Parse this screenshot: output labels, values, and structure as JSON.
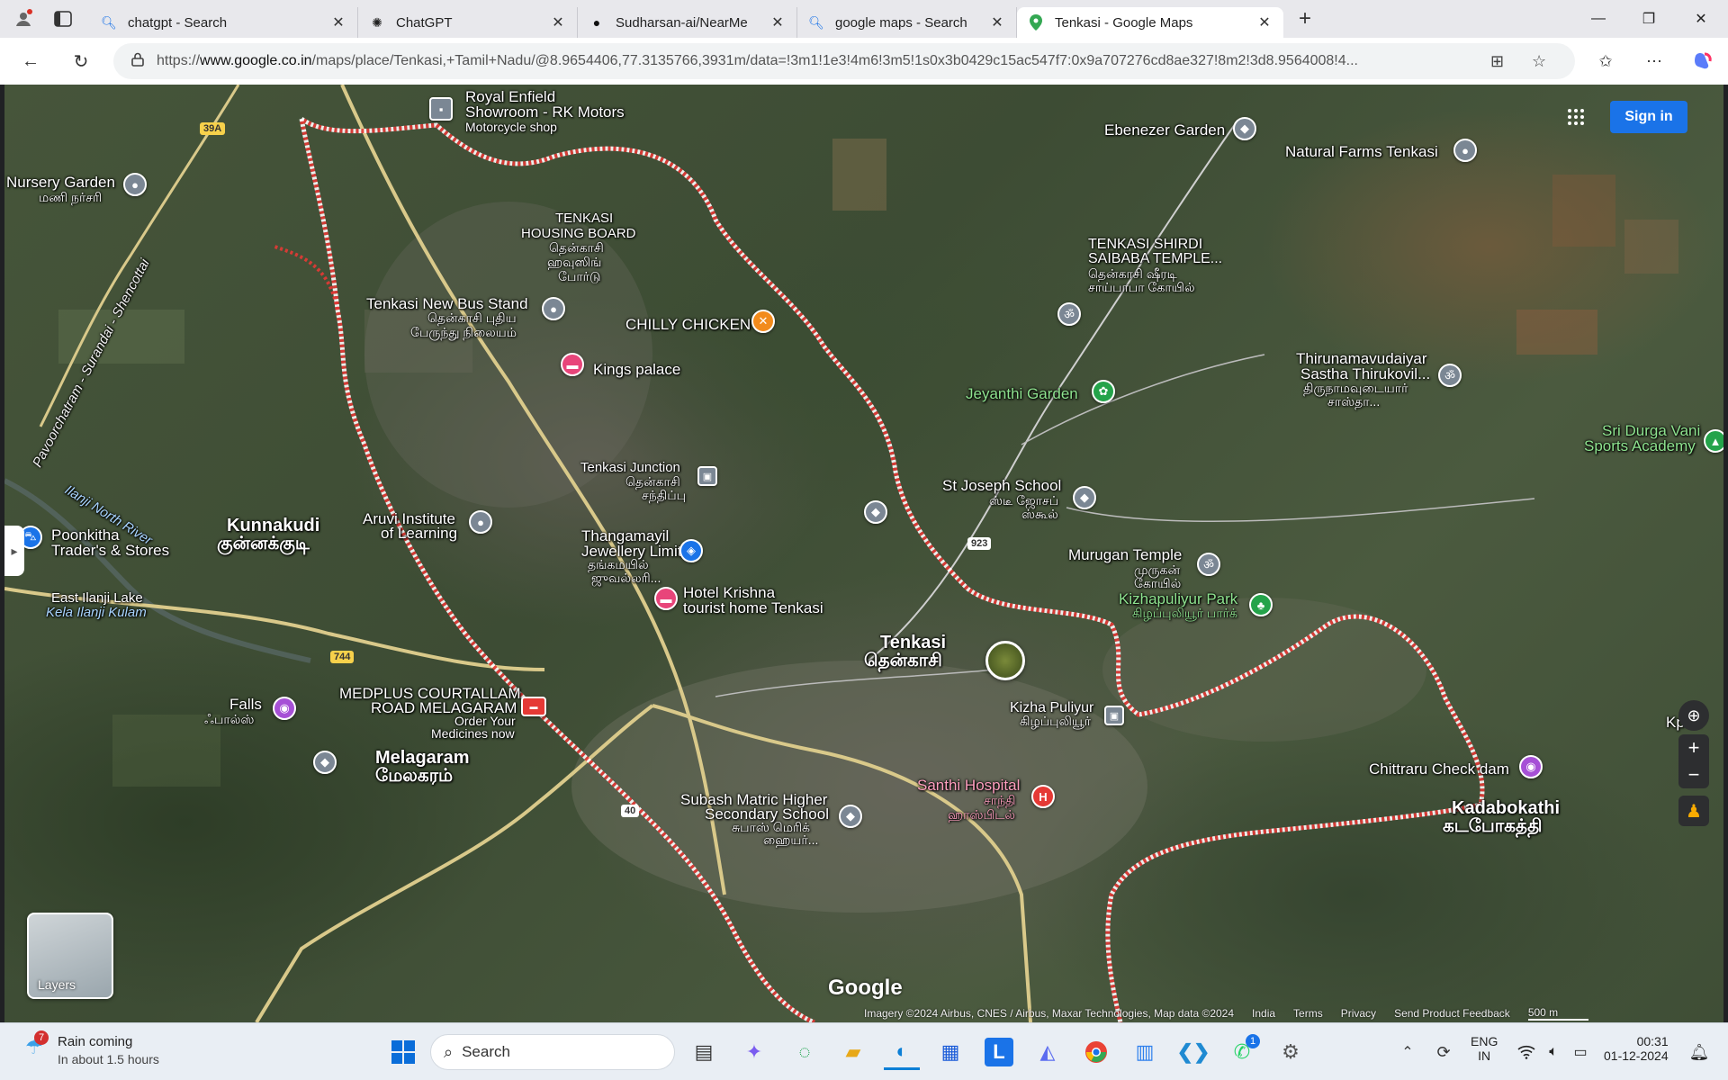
{
  "browser": {
    "tabs": [
      {
        "title": "chatgpt - Search",
        "icon": "search-icon"
      },
      {
        "title": "ChatGPT",
        "icon": "chatgpt-icon"
      },
      {
        "title": "Sudharsan-ai/NearMe",
        "icon": "github-icon"
      },
      {
        "title": "google maps - Search",
        "icon": "search-icon"
      },
      {
        "title": "Tenkasi - Google Maps",
        "icon": "maps-pin-icon"
      }
    ],
    "url_domain": "www.google.co.in",
    "url_prefix": "https://",
    "url_path": "/maps/place/Tenkasi,+Tamil+Nadu/@8.9654406,77.3135766,3931m/data=!3m1!1e3!4m6!3m5!1s0x3b0429c15ac547f7:0x9a707276cd8ae327!8m2!3d8.9564008!4..."
  },
  "map": {
    "signin_label": "Sign in",
    "layers_label": "Layers",
    "logo": "Google",
    "attribution": [
      "Imagery ©2024 Airbus, CNES / Airbus, Maxar Technologies, Map data ©2024",
      "India",
      "Terms",
      "Privacy",
      "Send Product Feedback",
      "500 m"
    ],
    "places": {
      "royal_enfield": [
        "Royal Enfield",
        "Showroom - RK Motors",
        "Motorcycle shop"
      ],
      "ebenezer": "Ebenezer Garden",
      "natural_farms": "Natural Farms Tenkasi",
      "nursery": [
        "Nursery Garden",
        "மணி நர்சரி"
      ],
      "housing_board": [
        "TENKASI",
        "HOUSING BOARD",
        "தென்காசி",
        "ஹவுஸிங்",
        "போர்டு"
      ],
      "shirdi": [
        "TENKASI SHIRDI",
        "SAIBABA TEMPLE...",
        "தென்காசி ஷீரடி",
        "சாய்பாபா கோயில்"
      ],
      "bus_stand": [
        "Tenkasi New Bus Stand",
        "தென்காசி புதிய",
        "பேருந்து நிலையம்"
      ],
      "chilly": "CHILLY CHICKEN",
      "kings": "Kings palace",
      "thiruna": [
        "Thirunamavudaiyar",
        "Sastha Thirukovil...",
        "திருநாமவுடையார்",
        "சாஸ்தா..."
      ],
      "jeyanthi": "Jeyanthi Garden",
      "sri_durga": [
        "Sri Durga Vani",
        "Sports Academy"
      ],
      "junction": [
        "Tenkasi Junction",
        "தென்காசி",
        "சந்திப்பு"
      ],
      "st_joseph": [
        "St Joseph School",
        "ஸ்டீ ஜோசப்",
        "ஸ்கூல்"
      ],
      "kunnakudi": [
        "Kunnakudi",
        "குன்னக்குடி"
      ],
      "aruvi": [
        "Aruvi Institute",
        "of Learning"
      ],
      "thangamayil": [
        "Thangamayil",
        "Jewellery Limited",
        "தங்கமயில்",
        "ஜுவல்லரி..."
      ],
      "poonkitha": [
        "Poonkitha",
        "Trader's & Stores"
      ],
      "murugan": [
        "Murugan Temple",
        "முருகன்",
        "கோயில்"
      ],
      "kizhapuliyur_park": [
        "Kizhapuliyur Park",
        "கிழப்புலியூர் பார்க்"
      ],
      "east_ilanji": [
        "East Ilanji Lake",
        "Kela Ilanji Kulam"
      ],
      "hotel_krishna": [
        "Hotel Krishna",
        "tourist home Tenkasi"
      ],
      "tenkasi": [
        "Tenkasi",
        "தென்காசி"
      ],
      "falls": [
        "Falls",
        "ஃபால்ஸ்"
      ],
      "medplus": [
        "MEDPLUS COURTALLAM",
        "ROAD MELAGARAM",
        "Order Your",
        "Medicines now"
      ],
      "kizha_puliyur": [
        "Kizha Puliyur",
        "கிழப்புலியூர்"
      ],
      "melagaram": [
        "Melagaram",
        "மேலகரம்"
      ],
      "chittraru": "Chittraru Check dam",
      "subash": [
        "Subash Matric Higher",
        "Secondary School",
        "சுபாஸ் மெரிக்",
        "ஹையர்..."
      ],
      "santhi": [
        "Santhi Hospital",
        "சாந்தி",
        "ஹாஸ்பிடல்"
      ],
      "kadabokathi": [
        "Kadabokathi",
        "கடபோகத்தி"
      ],
      "ilanji_river": "Ilanji North River",
      "road_name": "Pavoorchatram - Surandai - Shencottai",
      "edge_right": "Kpok"
    },
    "shields": [
      "39A",
      "744",
      "923",
      "40"
    ]
  },
  "taskbar": {
    "weather_title": "Rain coming",
    "weather_sub": "In about 1.5 hours",
    "weather_badge": "7",
    "search_placeholder": "Search",
    "lang_1": "ENG",
    "lang_2": "IN",
    "time": "00:31",
    "date": "01-12-2024",
    "whatsapp_badge": "1"
  }
}
